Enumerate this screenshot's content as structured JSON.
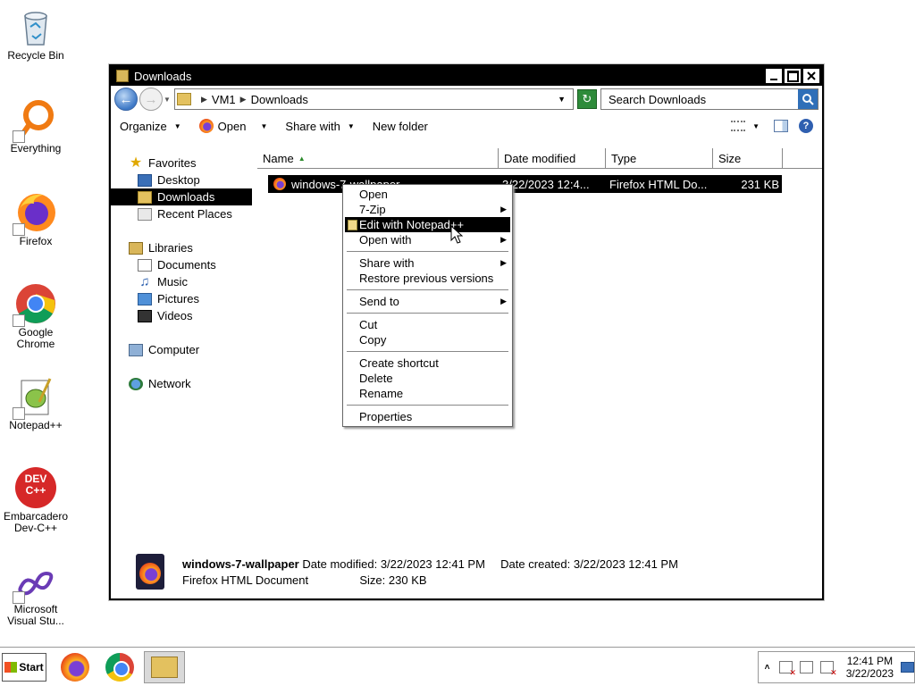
{
  "desktop": {
    "icons": [
      {
        "label": "Recycle Bin",
        "icon": "recycle-bin-icon"
      },
      {
        "label": "Everything",
        "icon": "everything-icon"
      },
      {
        "label": "Firefox",
        "icon": "firefox-icon"
      },
      {
        "label": "Google\nChrome",
        "icon": "chrome-icon"
      },
      {
        "label": "Notepad++",
        "icon": "notepadpp-icon"
      },
      {
        "label": "Embarcadero\nDev-C++",
        "icon": "devcpp-icon"
      },
      {
        "label": "Microsoft\nVisual Stu...",
        "icon": "visual-studio-icon"
      }
    ],
    "devcpp_badge": "DEV\nC++"
  },
  "window": {
    "title": "Downloads",
    "breadcrumb": [
      "VM1",
      "Downloads"
    ],
    "search_placeholder": "Search Downloads",
    "toolbar": {
      "organize": "Organize",
      "open": "Open",
      "share_with": "Share with",
      "new_folder": "New folder"
    },
    "nav": {
      "favorites": "Favorites",
      "desktop": "Desktop",
      "downloads": "Downloads",
      "recent_places": "Recent Places",
      "libraries": "Libraries",
      "documents": "Documents",
      "music": "Music",
      "pictures": "Pictures",
      "videos": "Videos",
      "computer": "Computer",
      "network": "Network"
    },
    "columns": {
      "name": "Name",
      "date_modified": "Date modified",
      "type": "Type",
      "size": "Size"
    },
    "files": [
      {
        "name": "windows-7-wallpaper",
        "date_modified": "3/22/2023 12:4...",
        "type": "Firefox HTML Do...",
        "size": "231 KB"
      }
    ],
    "details": {
      "name": "windows-7-wallpaper",
      "date_modified_label": "Date modified:",
      "date_modified": "3/22/2023 12:41 PM",
      "date_created_label": "Date created:",
      "date_created": "3/22/2023 12:41 PM",
      "type": "Firefox HTML Document",
      "size_label": "Size:",
      "size": "230 KB"
    }
  },
  "context_menu": {
    "items": [
      {
        "label": "Open"
      },
      {
        "label": "7-Zip",
        "submenu": true
      },
      {
        "label": "Edit with Notepad++",
        "highlighted": true
      },
      {
        "label": "Open with",
        "submenu": true
      },
      {
        "label": "Share with",
        "submenu": true
      },
      {
        "label": "Restore previous versions"
      },
      {
        "label": "Send to",
        "submenu": true
      },
      {
        "label": "Cut"
      },
      {
        "label": "Copy"
      },
      {
        "label": "Create shortcut"
      },
      {
        "label": "Delete"
      },
      {
        "label": "Rename"
      },
      {
        "label": "Properties"
      }
    ]
  },
  "taskbar": {
    "start_label": "Start",
    "clock_time": "12:41 PM",
    "clock_date": "3/22/2023"
  }
}
